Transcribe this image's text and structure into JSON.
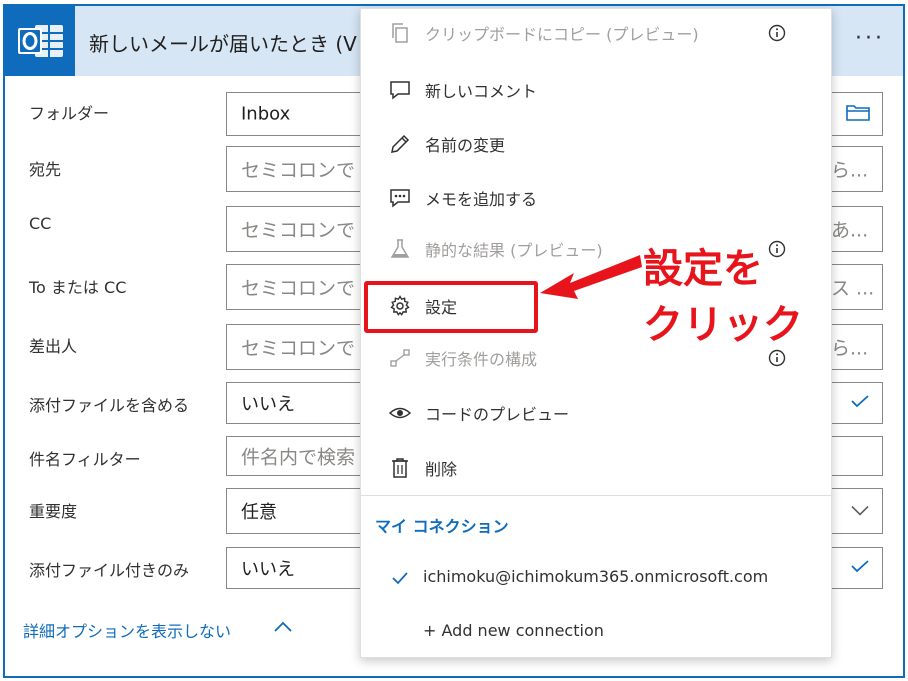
{
  "header": {
    "title": "新しいメールが届いたとき (V",
    "more_label": "···",
    "icon": "outlook-icon"
  },
  "fields": [
    {
      "label": "フォルダー",
      "value": "Inbox",
      "kind": "value",
      "right_icon": "folder-icon"
    },
    {
      "label": "宛先",
      "value": "セミコロンで",
      "kind": "placeholder",
      "right_fragment": "ら..."
    },
    {
      "label": "CC",
      "value": "セミコロンで",
      "kind": "placeholder",
      "right_fragment": "あ..."
    },
    {
      "label": "To または CC",
      "value": "セミコロンで",
      "kind": "placeholder",
      "right_fragment": "ス ..."
    },
    {
      "label": "差出人",
      "value": "セミコロンで",
      "kind": "placeholder",
      "right_fragment": "ら..."
    },
    {
      "label": "添付ファイルを含める",
      "value": "いいえ",
      "kind": "value",
      "right_icon": "check-icon"
    },
    {
      "label": "件名フィルター",
      "value": "件名内で検索",
      "kind": "placeholder"
    },
    {
      "label": "重要度",
      "value": "任意",
      "kind": "value",
      "right_icon": "chevron-down-icon"
    },
    {
      "label": "添付ファイル付きのみ",
      "value": "いいえ",
      "kind": "value",
      "right_icon": "check-icon"
    }
  ],
  "show_less": {
    "label": "詳細オプションを表示しない"
  },
  "menu": {
    "items": [
      {
        "label": "クリップボードにコピー (プレビュー)",
        "icon": "copy-icon",
        "disabled": true,
        "info": true
      },
      {
        "label": "新しいコメント",
        "icon": "comment-icon",
        "disabled": false,
        "info": false
      },
      {
        "label": "名前の変更",
        "icon": "pencil-icon",
        "disabled": false,
        "info": false
      },
      {
        "label": "メモを追加する",
        "icon": "note-icon",
        "disabled": false,
        "info": false
      },
      {
        "label": "静的な結果 (プレビュー)",
        "icon": "flask-icon",
        "disabled": true,
        "info": true
      },
      {
        "label": "設定",
        "icon": "gear-icon",
        "disabled": false,
        "info": false
      },
      {
        "label": "実行条件の構成",
        "icon": "run-after-icon",
        "disabled": true,
        "info": true
      },
      {
        "label": "コードのプレビュー",
        "icon": "eye-icon",
        "disabled": false,
        "info": false
      },
      {
        "label": "削除",
        "icon": "trash-icon",
        "disabled": false,
        "info": false
      }
    ],
    "connections_title": "マイ コネクション",
    "connection_account": "ichimoku@ichimokum365.onmicrosoft.com",
    "add_connection": "+ Add new connection"
  },
  "annotation": {
    "line1": "設定を",
    "line2": "クリック",
    "color": "#e8141c"
  },
  "colors": {
    "accent": "#0f6cbd",
    "header_bg": "#d6e6f5"
  }
}
